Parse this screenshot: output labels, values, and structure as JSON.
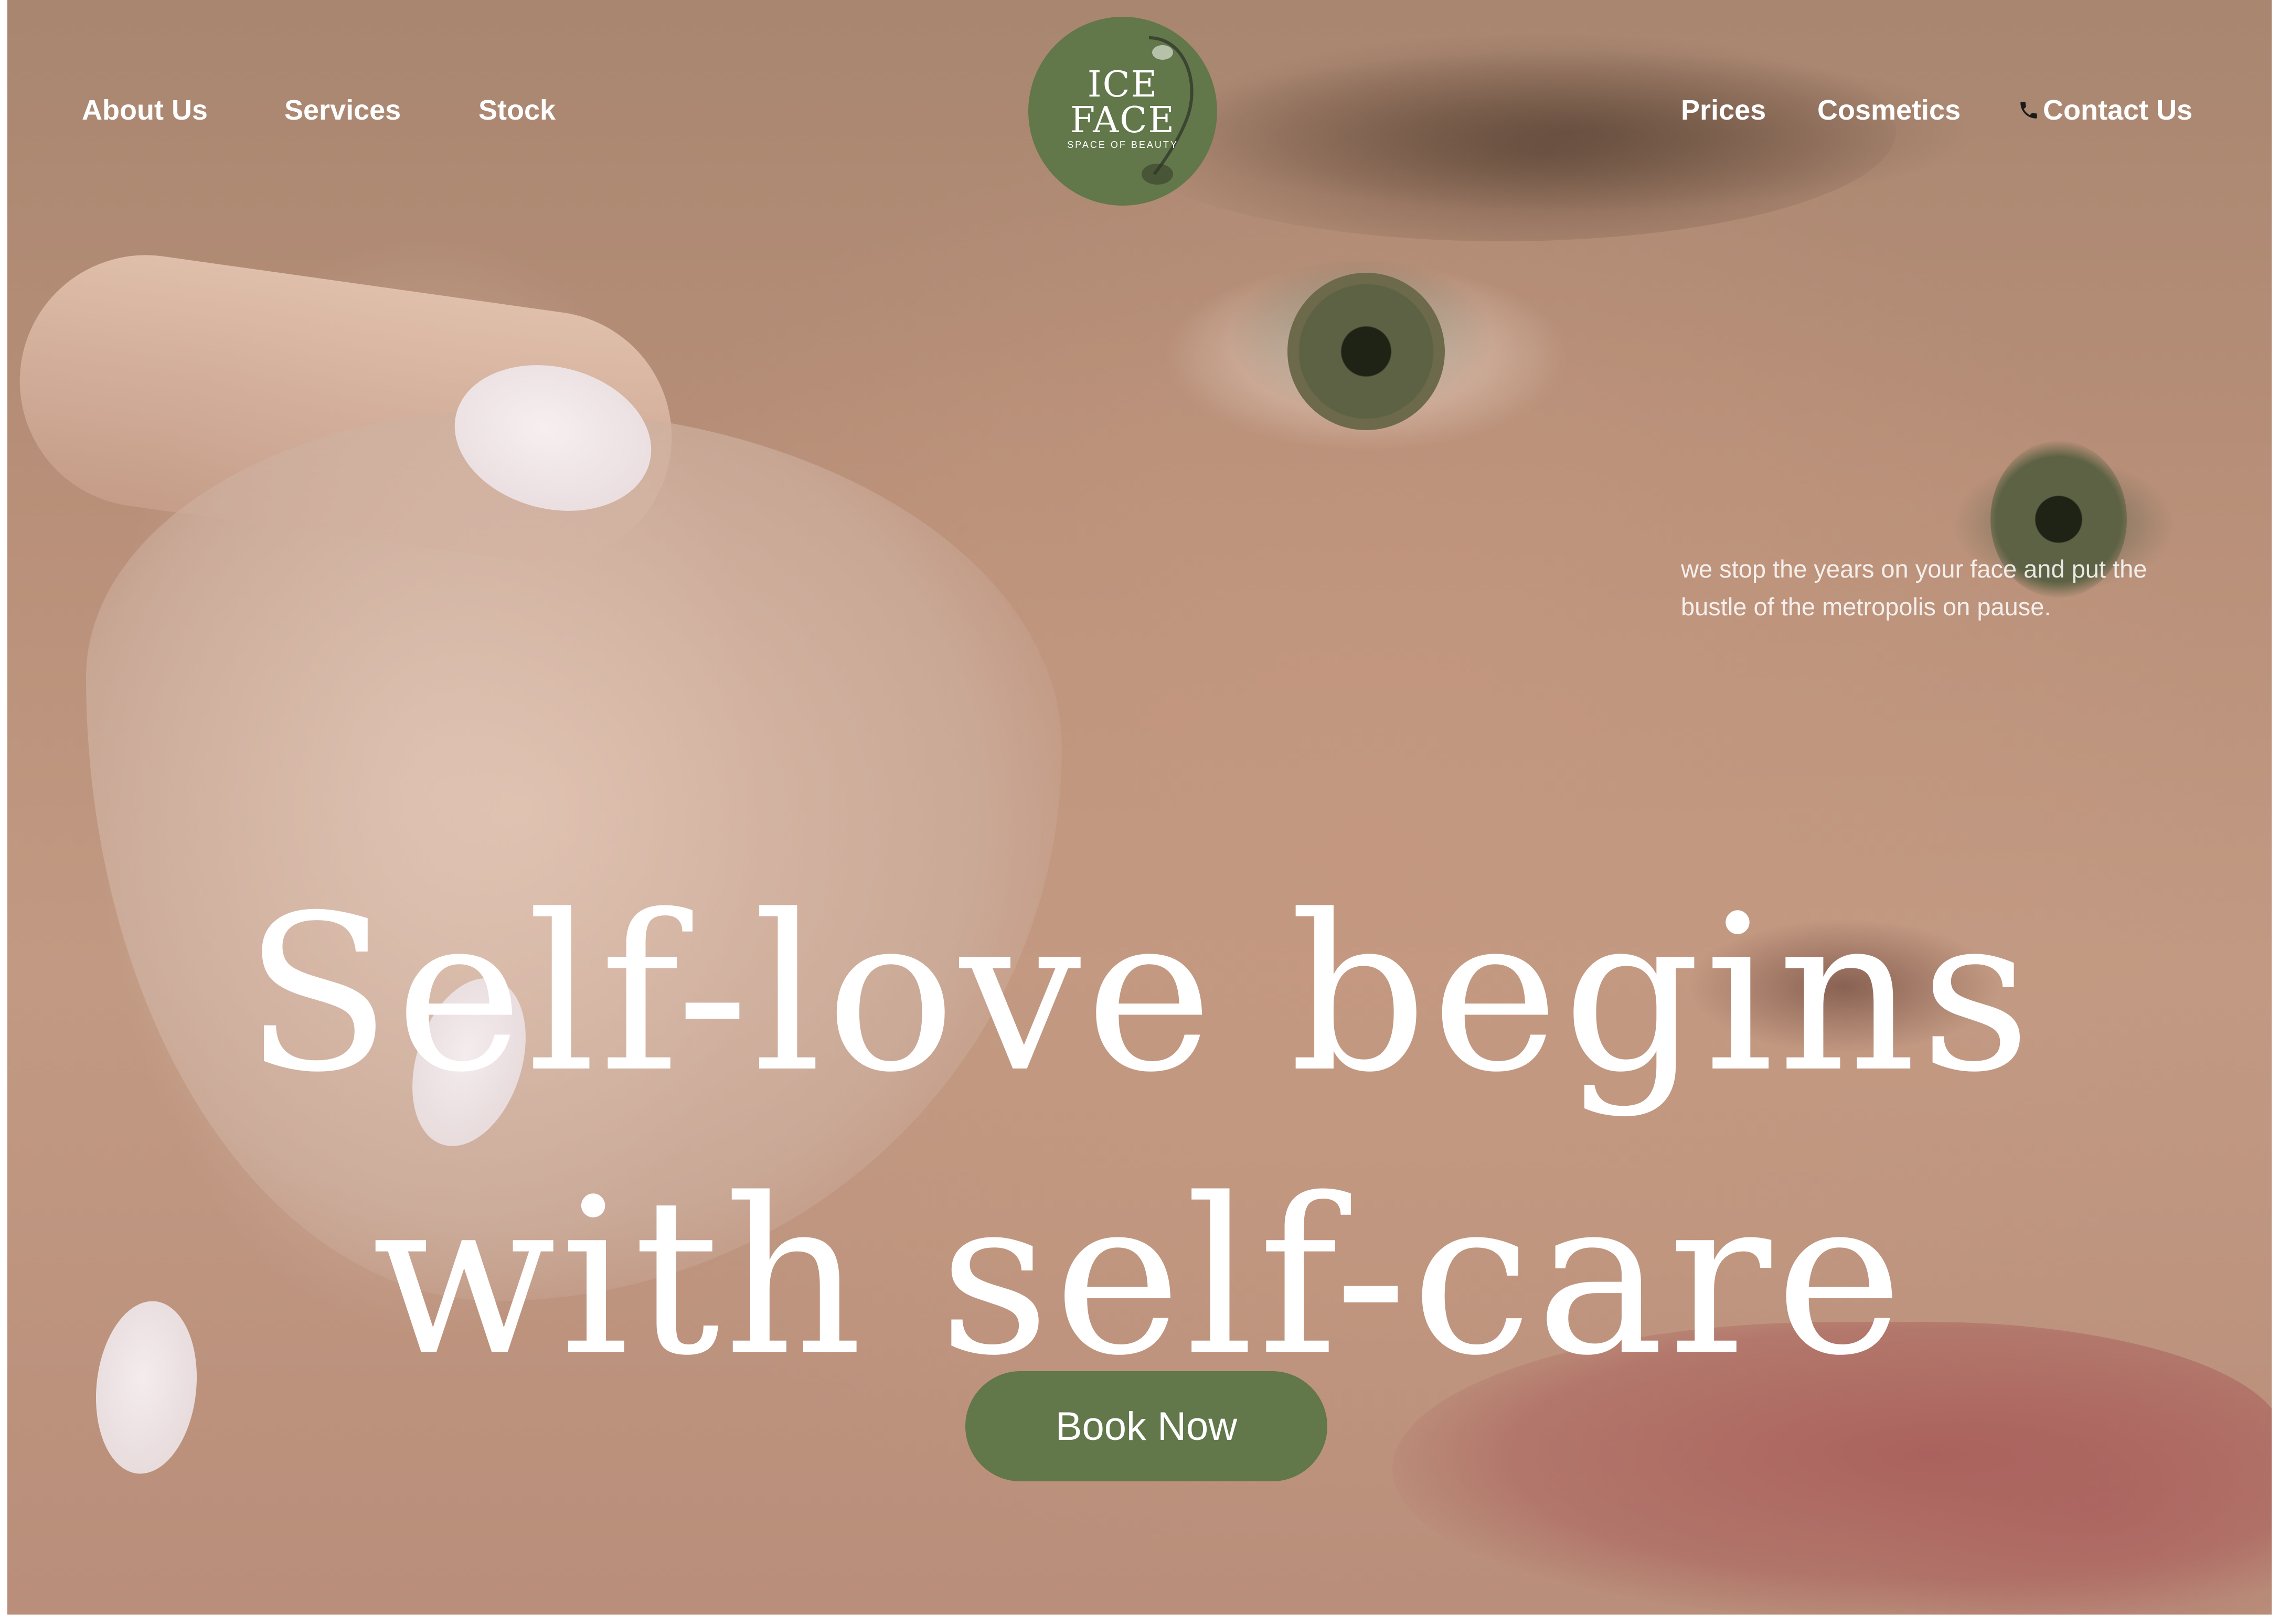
{
  "nav": {
    "left_items": [
      "About Us",
      "Services",
      "Stock"
    ],
    "right_items": [
      "Prices",
      "Cosmetics",
      "Contact Us"
    ],
    "contact_icon": "phone-icon"
  },
  "logo": {
    "line1": "ICE",
    "line2": "FACE",
    "tagline": "SPACE OF BEAUTY",
    "color": "#62774a"
  },
  "hero": {
    "tagline": "we stop the years on your face and put the bustle of the metropolis on pause.",
    "headline_line1": "Self-love begins",
    "headline_line2": "with self-care",
    "cta_label": "Book Now"
  },
  "colors": {
    "accent": "#62774a",
    "text": "#ffffff"
  }
}
